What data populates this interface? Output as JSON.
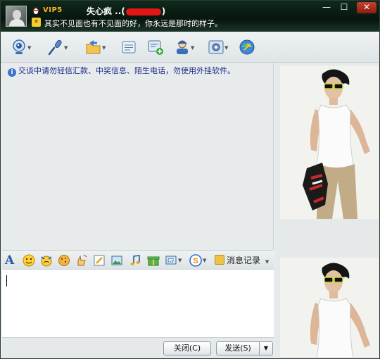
{
  "title_bar": {
    "vip_badge": "VIP5",
    "nickname_prefix": "失心疯 ..(",
    "nickname_suffix": ")",
    "signature": "其实不见面也有不见面的好，你永远是那时的样子。",
    "minimize_glyph": "—",
    "maximize_glyph": "☐",
    "close_glyph": "✕"
  },
  "toolbar": {
    "buttons": [
      {
        "icon": "webcam-icon",
        "has_dropdown": true
      },
      {
        "icon": "microphone-icon",
        "has_dropdown": true
      },
      {
        "icon": "folder-transfer-icon",
        "has_dropdown": true
      },
      {
        "icon": "message-icon",
        "has_dropdown": false
      },
      {
        "icon": "add-contact-icon",
        "has_dropdown": false
      },
      {
        "icon": "group-chat-icon",
        "has_dropdown": true
      },
      {
        "icon": "app-settings-icon",
        "has_dropdown": true
      },
      {
        "icon": "remote-assist-icon",
        "has_dropdown": false
      }
    ],
    "dropdown_glyph": "▼"
  },
  "chat": {
    "notice": "交谈中请勿轻信汇款、中奖信息、陌生电话，勿使用外挂软件。"
  },
  "format_bar": {
    "font_glyph": "A",
    "items": [
      "font-icon",
      "emoji-icon",
      "magic-face-icon",
      "cookie-icon",
      "shake-icon",
      "doodle-icon",
      "image-icon",
      "music-icon",
      "gift-icon",
      "screenshot-icon",
      "soso-icon"
    ],
    "history_label": "消息记录",
    "dropdown_glyph": "▼"
  },
  "buttons": {
    "close_label": "关闭(C)",
    "send_label": "发送(S)",
    "send_dropdown": "▼"
  },
  "colors": {
    "title_bar": "#0f2a1c",
    "vip": "#ffb21e",
    "notice_text": "#1e2a8c"
  }
}
